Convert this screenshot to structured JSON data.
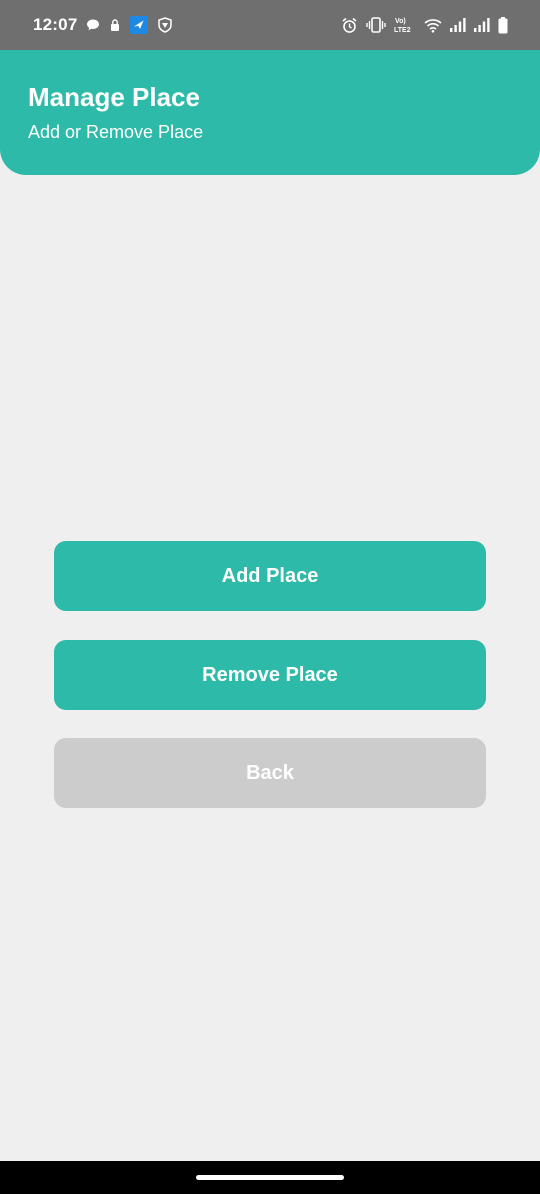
{
  "status_bar": {
    "time": "12:07",
    "left_icons": [
      "chat-bubble-icon",
      "lock-icon",
      "app-notification-icon",
      "vpn-shield-icon"
    ],
    "right_icons": [
      "alarm-icon",
      "vibrate-icon",
      "volte-icon",
      "wifi-icon",
      "signal-icon",
      "signal-icon",
      "battery-icon"
    ],
    "volte_label_top": "Vo)",
    "volte_label_bottom": "LTE2"
  },
  "header": {
    "title": "Manage Place",
    "subtitle": "Add or Remove Place"
  },
  "buttons": {
    "add_label": "Add Place",
    "remove_label": "Remove Place",
    "back_label": "Back"
  },
  "colors": {
    "accent": "#2dbaa8",
    "background": "#efefef",
    "disabled": "#cccccc",
    "status_bar": "#6f6f6f"
  }
}
